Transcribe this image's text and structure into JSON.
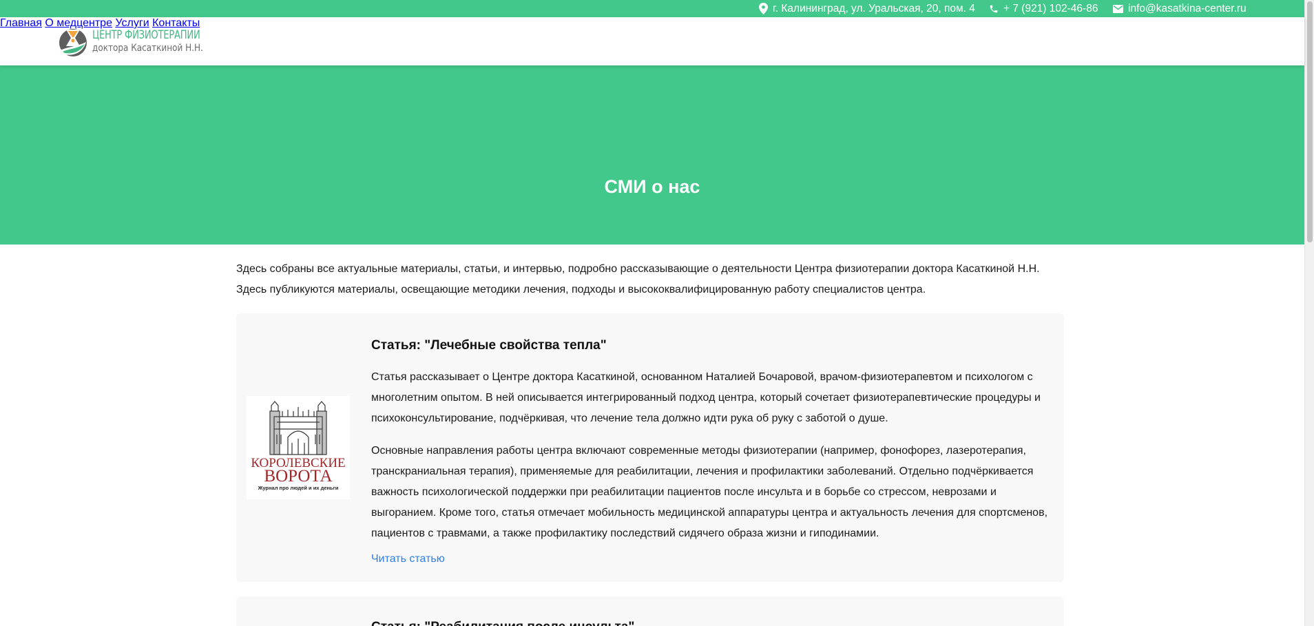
{
  "topbar": {
    "address": "г. Калининград, ул. Уральская, 20, пом. 4",
    "phone": "+ 7 (921) 102-46-86",
    "email": "info@kasatkina-center.ru",
    "address_icon": "location-pin-icon",
    "phone_icon": "phone-icon",
    "email_icon": "envelope-icon",
    "bg_color": "#43c88b"
  },
  "header": {
    "logo": {
      "line1": "ЦЕНТР ФИЗИОТЕРАПИИ",
      "line2": "доктора Касаткиной Н.Н."
    },
    "nav": [
      {
        "label": "Главная"
      },
      {
        "label": "О медцентре"
      },
      {
        "label": "Услуги"
      },
      {
        "label": "Контакты"
      }
    ]
  },
  "hero": {
    "title": "СМИ о нас"
  },
  "intro": "Здесь собраны все актуальные материалы, статьи, и интервью, подробно рассказывающие о деятельности Центра физиотерапии доктора Касаткиной Н.Н. Здесь публикуются материалы, освещающие методики лечения, подходы и высококвалифицированную работу специалистов центра.",
  "articles": [
    {
      "title": "Статья: \"Лечебные свойства тепла\"",
      "image": {
        "brand_line1": "КОРОЛЕВСКИЕ",
        "brand_line2": "ВОРОТА",
        "tagline": "Журнал про людей и их деньги"
      },
      "paragraph1": "Статья рассказывает о Центре доктора Касаткиной, основанном Наталией Бочаровой, врачом-физиотерапевтом и психологом с многолетним опытом. В ней описывается интегрированный подход центра, который сочетает физиотерапевтические процедуры и психоконсультирование, подчёркивая, что лечение тела должно идти рука об руку с заботой о душе.",
      "paragraph2": "Основные направления работы центра включают современные методы физиотерапии (например, фонофорез, лазеротерапия, транскраниальная терапия), применяемые для реабилитации, лечения и профилактики заболеваний. Отдельно подчёркивается важность психологической поддержки при реабилитации пациентов после инсульта и в борьбе со стрессом, неврозами и выгоранием. Кроме того, статья отмечает мобильность медицинской аппаратуры центра и актуальность лечения для спортсменов, пациентов с травмами, а также профилактику последствий сидячего образа жизни и гиподинамии.",
      "link_label": "Читать статью"
    },
    {
      "title": "Статья: \"Реабилитация после инсульта\""
    }
  ],
  "colors": {
    "accent": "#43c88b",
    "link": "#2f80ed",
    "card_bg": "#f8f8f8",
    "brand_red": "#a3262a"
  }
}
